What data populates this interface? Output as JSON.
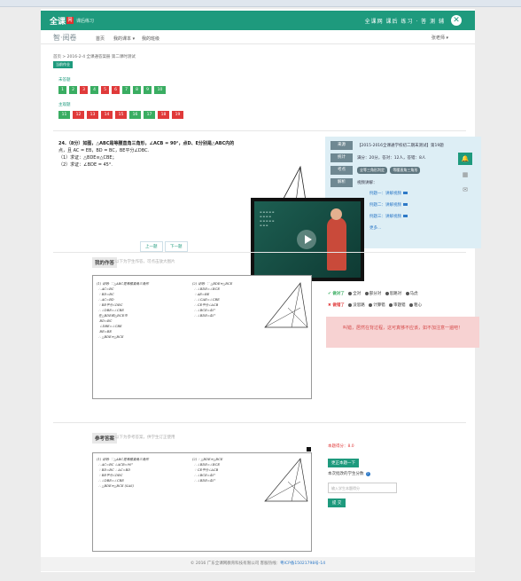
{
  "header": {
    "logo": "全课",
    "logo_mark": "网",
    "logo_sub": "课后练习",
    "slogan": "全课网 课后 练习 · 答 测 辅",
    "close_icon": "x-circle-icon"
  },
  "nav": {
    "brand": "智·阅卷",
    "items": [
      "首页",
      "我的课本 ▾",
      "我的班级"
    ],
    "user": "张老师 ▾"
  },
  "breadcrumb": {
    "path": "首页 > 2016-2-4 全课通答案册 第二课时测试",
    "tag": "当前作业"
  },
  "answered": {
    "label": "未答题",
    "items": [
      {
        "n": "1",
        "s": "g"
      },
      {
        "n": "2",
        "s": "g"
      },
      {
        "n": "3",
        "s": "r"
      },
      {
        "n": "4",
        "s": "g"
      },
      {
        "n": "5",
        "s": "r"
      },
      {
        "n": "6",
        "s": "r"
      },
      {
        "n": "7",
        "s": "g"
      },
      {
        "n": "8",
        "s": "g"
      },
      {
        "n": "9",
        "s": "g"
      },
      {
        "n": "10",
        "s": "g"
      }
    ]
  },
  "wrong": {
    "label": "主观题",
    "items": [
      {
        "n": "11",
        "s": "g"
      },
      {
        "n": "12",
        "s": "r"
      },
      {
        "n": "13",
        "s": "r"
      },
      {
        "n": "14",
        "s": "r"
      },
      {
        "n": "15",
        "s": "r"
      },
      {
        "n": "16",
        "s": "g"
      },
      {
        "n": "17",
        "s": "g"
      },
      {
        "n": "18",
        "s": "r"
      },
      {
        "n": "19",
        "s": "r"
      }
    ]
  },
  "question": {
    "line1": "24.（8分）如图，△ABC是等腰直角三角形，∠ACB = 90°，点D、E分别是△ABC内的",
    "line2": "点，且 AC = EB，BD = BC，BE平分∠DBC.",
    "line3": "（1）求证：△BDE≌△CBE；",
    "line4": "（2）求证：∠BDE = 45°.",
    "prev": "上一题",
    "next": "下一题"
  },
  "info": {
    "source_label": "来源",
    "source": "【2015-2016全课通学校初二期末测试】第19题",
    "stat_label": "统计",
    "stat": "满分：20分，答对：12人，答错：8人",
    "kp_label": "考点",
    "kp": [
      "全等三角形判定",
      "等腰直角三角形"
    ],
    "video_label": "解析",
    "video_intro": "视频讲解：",
    "videos": [
      "例题一：讲解视频",
      "例题二：讲解视频",
      "例题三：讲解视频",
      "更多..."
    ]
  },
  "mywork": {
    "label": "我的作答",
    "hint": "以下为学生作答，可点击放大图片"
  },
  "judge": {
    "right_label": "✔ 做对了",
    "right_opts": [
      "全对",
      "部分对",
      "思路对",
      "马虎"
    ],
    "wrong_label": "✖ 做错了",
    "wrong_opts": [
      "没思路",
      "计算错",
      "审题错",
      "粗心"
    ],
    "warn": "叫错，居然在背过程，这可真够不应该，如不加注意一遍吧！"
  },
  "ref": {
    "label": "参考答案",
    "hint": "以下为参考答案，供学生订正使用",
    "score": "本题得分：8.0",
    "btn": "更正本题一下",
    "score_q": "本次批改的学生分数",
    "input_ph": "输入学生本题得分",
    "submit": "提 交"
  },
  "footer": {
    "text": "© 2016 广东全课网教育科技有限公司  客服热线：",
    "link": "粤ICP备15021798号-14"
  },
  "side": [
    "bell-icon",
    "qr-icon",
    "mail-icon"
  ],
  "colors": {
    "brand": "#1e9a7d",
    "error": "#e03a3a",
    "correct": "#3aad62",
    "link": "#2d79c7"
  }
}
